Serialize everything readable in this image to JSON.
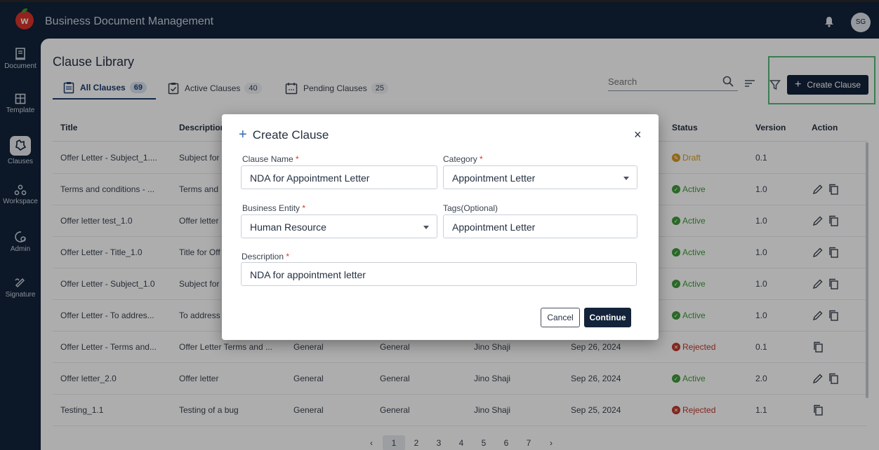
{
  "app": {
    "title": "Business Document Management",
    "logo_letter": "w",
    "avatar_initials": "SG"
  },
  "sidebar": {
    "items": [
      {
        "label": "Document",
        "icon": "document-icon"
      },
      {
        "label": "Template",
        "icon": "template-icon"
      },
      {
        "label": "Clauses",
        "icon": "clauses-icon",
        "active": true
      },
      {
        "label": "Workspace",
        "icon": "workspace-icon"
      },
      {
        "label": "Admin",
        "icon": "admin-icon"
      },
      {
        "label": "Signature",
        "icon": "signature-icon"
      }
    ]
  },
  "page": {
    "title": "Clause Library"
  },
  "tabs": [
    {
      "label": "All Clauses",
      "count": "69",
      "active": true
    },
    {
      "label": "Active Clauses",
      "count": "40"
    },
    {
      "label": "Pending Clauses",
      "count": "25"
    }
  ],
  "search": {
    "placeholder": "Search"
  },
  "toolbar": {
    "create_label": "Create Clause"
  },
  "table": {
    "columns": [
      "Title",
      "Description",
      "Status",
      "Version",
      "Action"
    ],
    "rows": [
      {
        "title": "Offer Letter - Subject_1....",
        "description": "Subject for",
        "cat": "",
        "type": "",
        "owner": "",
        "date": "",
        "status": "Draft",
        "version": "0.1",
        "edit": false,
        "copy": false
      },
      {
        "title": "Terms and conditions - ...",
        "description": "Terms and",
        "cat": "",
        "type": "",
        "owner": "",
        "date": "",
        "status": "Active",
        "version": "1.0",
        "edit": true,
        "copy": true
      },
      {
        "title": "Offer letter test_1.0",
        "description": "Offer letter",
        "cat": "",
        "type": "",
        "owner": "",
        "date": "",
        "status": "Active",
        "version": "1.0",
        "edit": true,
        "copy": true
      },
      {
        "title": "Offer Letter - Title_1.0",
        "description": "Title for Off",
        "cat": "",
        "type": "",
        "owner": "",
        "date": "",
        "status": "Active",
        "version": "1.0",
        "edit": true,
        "copy": true
      },
      {
        "title": "Offer Letter - Subject_1.0",
        "description": "Subject for",
        "cat": "",
        "type": "",
        "owner": "",
        "date": "",
        "status": "Active",
        "version": "1.0",
        "edit": true,
        "copy": true
      },
      {
        "title": "Offer Letter - To addres...",
        "description": "To address",
        "cat": "",
        "type": "",
        "owner": "",
        "date": "",
        "status": "Active",
        "version": "1.0",
        "edit": true,
        "copy": true
      },
      {
        "title": "Offer Letter - Terms and...",
        "description": "Offer Letter Terms and ...",
        "cat": "General",
        "type": "General",
        "owner": "Jino Shaji",
        "date": "Sep 26, 2024",
        "status": "Rejected",
        "version": "0.1",
        "edit": false,
        "copy": true
      },
      {
        "title": "Offer letter_2.0",
        "description": "Offer letter",
        "cat": "General",
        "type": "General",
        "owner": "Jino Shaji",
        "date": "Sep 26, 2024",
        "status": "Active",
        "version": "2.0",
        "edit": true,
        "copy": true
      },
      {
        "title": "Testing_1.1",
        "description": "Testing of a bug",
        "cat": "General",
        "type": "General",
        "owner": "Jino Shaji",
        "date": "Sep 25, 2024",
        "status": "Rejected",
        "version": "1.1",
        "edit": false,
        "copy": true
      }
    ]
  },
  "status_colors": {
    "Draft": "#d99a1e",
    "Active": "#3f9b3a",
    "Rejected": "#c0392b"
  },
  "pagination": {
    "prev": "‹",
    "pages": [
      "1",
      "2",
      "3",
      "4",
      "5",
      "6",
      "7"
    ],
    "current": "1",
    "next": "›"
  },
  "modal": {
    "title": "Create Clause",
    "close": "×",
    "clause_name_label": "Clause Name",
    "clause_name_value": "NDA for Appointment Letter",
    "category_label": "Category",
    "category_value": "Appointment Letter",
    "entity_label": "Business Entity",
    "entity_value": "Human Resource",
    "tags_label": "Tags(Optional)",
    "tags_value": "Appointment Letter",
    "description_label": "Description",
    "description_value": "NDA for appointment letter",
    "required_mark": "*",
    "cancel_label": "Cancel",
    "continue_label": "Continue"
  }
}
